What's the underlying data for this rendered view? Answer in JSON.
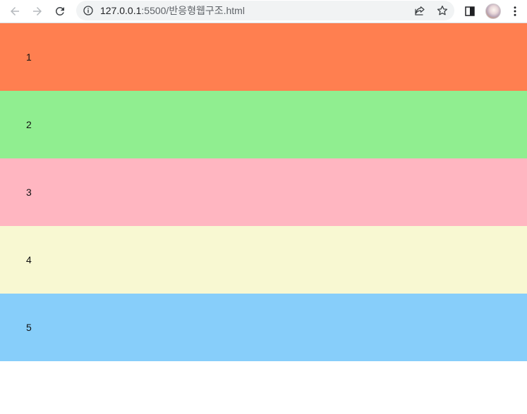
{
  "browser": {
    "url_host": "127.0.0.1",
    "url_rest": ":5500/반응형웹구조.html",
    "icons": {
      "back": "arrow-left-icon",
      "forward": "arrow-right-icon",
      "reload": "reload-icon",
      "info": "info-icon",
      "share": "share-icon",
      "bookmark": "star-icon",
      "sidepanel": "side-panel-icon",
      "menu": "kebab-menu-icon"
    }
  },
  "rows": [
    {
      "label": "1",
      "color": "#ff7f50"
    },
    {
      "label": "2",
      "color": "#90ee90"
    },
    {
      "label": "3",
      "color": "#ffb6c1"
    },
    {
      "label": "4",
      "color": "#f8f8d2"
    },
    {
      "label": "5",
      "color": "#87cefa"
    }
  ]
}
